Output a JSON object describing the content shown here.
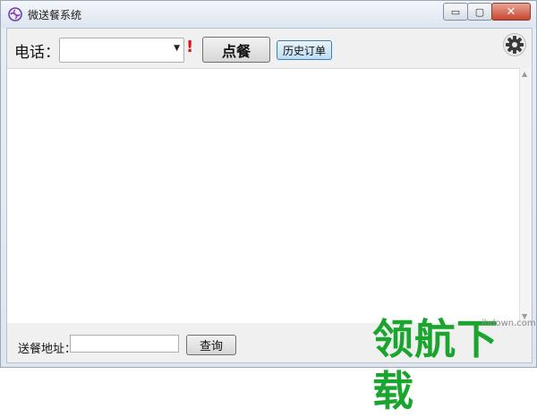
{
  "window": {
    "title": "微送餐系统",
    "minimize_glyph": "▭",
    "maximize_glyph": "▢",
    "close_glyph": "✕"
  },
  "toolbar": {
    "phone_label": "电话：",
    "phone_value": "",
    "required_mark": "!",
    "order_button": "点餐",
    "history_button": "历史订单",
    "settings_icon": "gear-icon"
  },
  "footer": {
    "address_label": "送餐地址：",
    "address_value": "",
    "query_button": "查询"
  },
  "watermark": {
    "url": "ihdown.com",
    "logo_text": "领航下载"
  },
  "colors": {
    "required": "#dd1111",
    "watermark_green": "#1aa52e"
  }
}
